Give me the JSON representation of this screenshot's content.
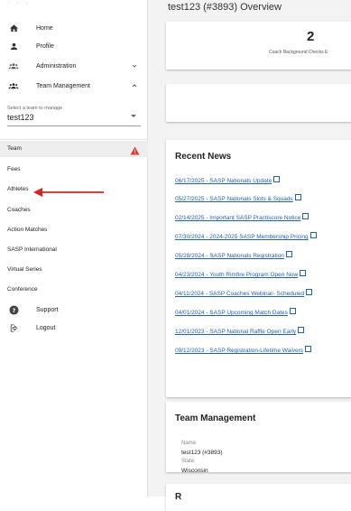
{
  "sidebar": {
    "items": [
      {
        "label": "Home",
        "icon": "home-icon"
      },
      {
        "label": "Profile",
        "icon": "person-icon"
      },
      {
        "label": "Administration",
        "icon": "group-icon",
        "chevron": "down"
      },
      {
        "label": "Team Management",
        "icon": "group-icon",
        "chevron": "up"
      }
    ],
    "team_select": {
      "label": "Select a team to manage",
      "value": "test123"
    },
    "section_items": [
      {
        "label": "Team"
      },
      {
        "label": "Fees"
      },
      {
        "label": "Athletes"
      },
      {
        "label": "Coaches"
      },
      {
        "label": "Action Matches"
      },
      {
        "label": "SASP International"
      },
      {
        "label": "Virtual Series"
      },
      {
        "label": "Conference"
      }
    ],
    "bottom_items": [
      {
        "label": "Support",
        "icon": "help-icon"
      },
      {
        "label": "Logout",
        "icon": "logout-icon"
      }
    ]
  },
  "main": {
    "title": "test123 (#3893) Overview",
    "stat": {
      "value": "2",
      "label": "Coach Background Checks E"
    },
    "recent_news": {
      "title": "Recent News",
      "items": [
        "06/17/2025 - SASP Nationals Update",
        "05/27/2025 - SASP Nationals Slots & Squads",
        "02/14/2025 - Important SASP Practiscore Notice",
        "07/30/2024 - 2024-2025 SASP Membership Pricing",
        "05/28/2024 - SASP Nationals Registration",
        "04/23/2024 - Youth Rimfire Program Open Now",
        "04/11/2024 - SASP Coaches Webinar- Scheduled",
        "04/01/2024 - SASP Upcoming Match Dates",
        "12/01/2023 - SASP National Raffle Open Early",
        "09/12/2023 - SASP Registration-Lifetime Waivers"
      ]
    },
    "team_management": {
      "title": "Team Management",
      "name_label": "Name:",
      "name_value": "test123 (#3893)",
      "state_label": "State:",
      "state_value": "Wisconsin"
    },
    "next_card_title": "R"
  },
  "colors": {
    "link": "#1f5fb8",
    "warning": "#e53935",
    "arrow": "#e02020",
    "background": "#f3f3f3"
  }
}
